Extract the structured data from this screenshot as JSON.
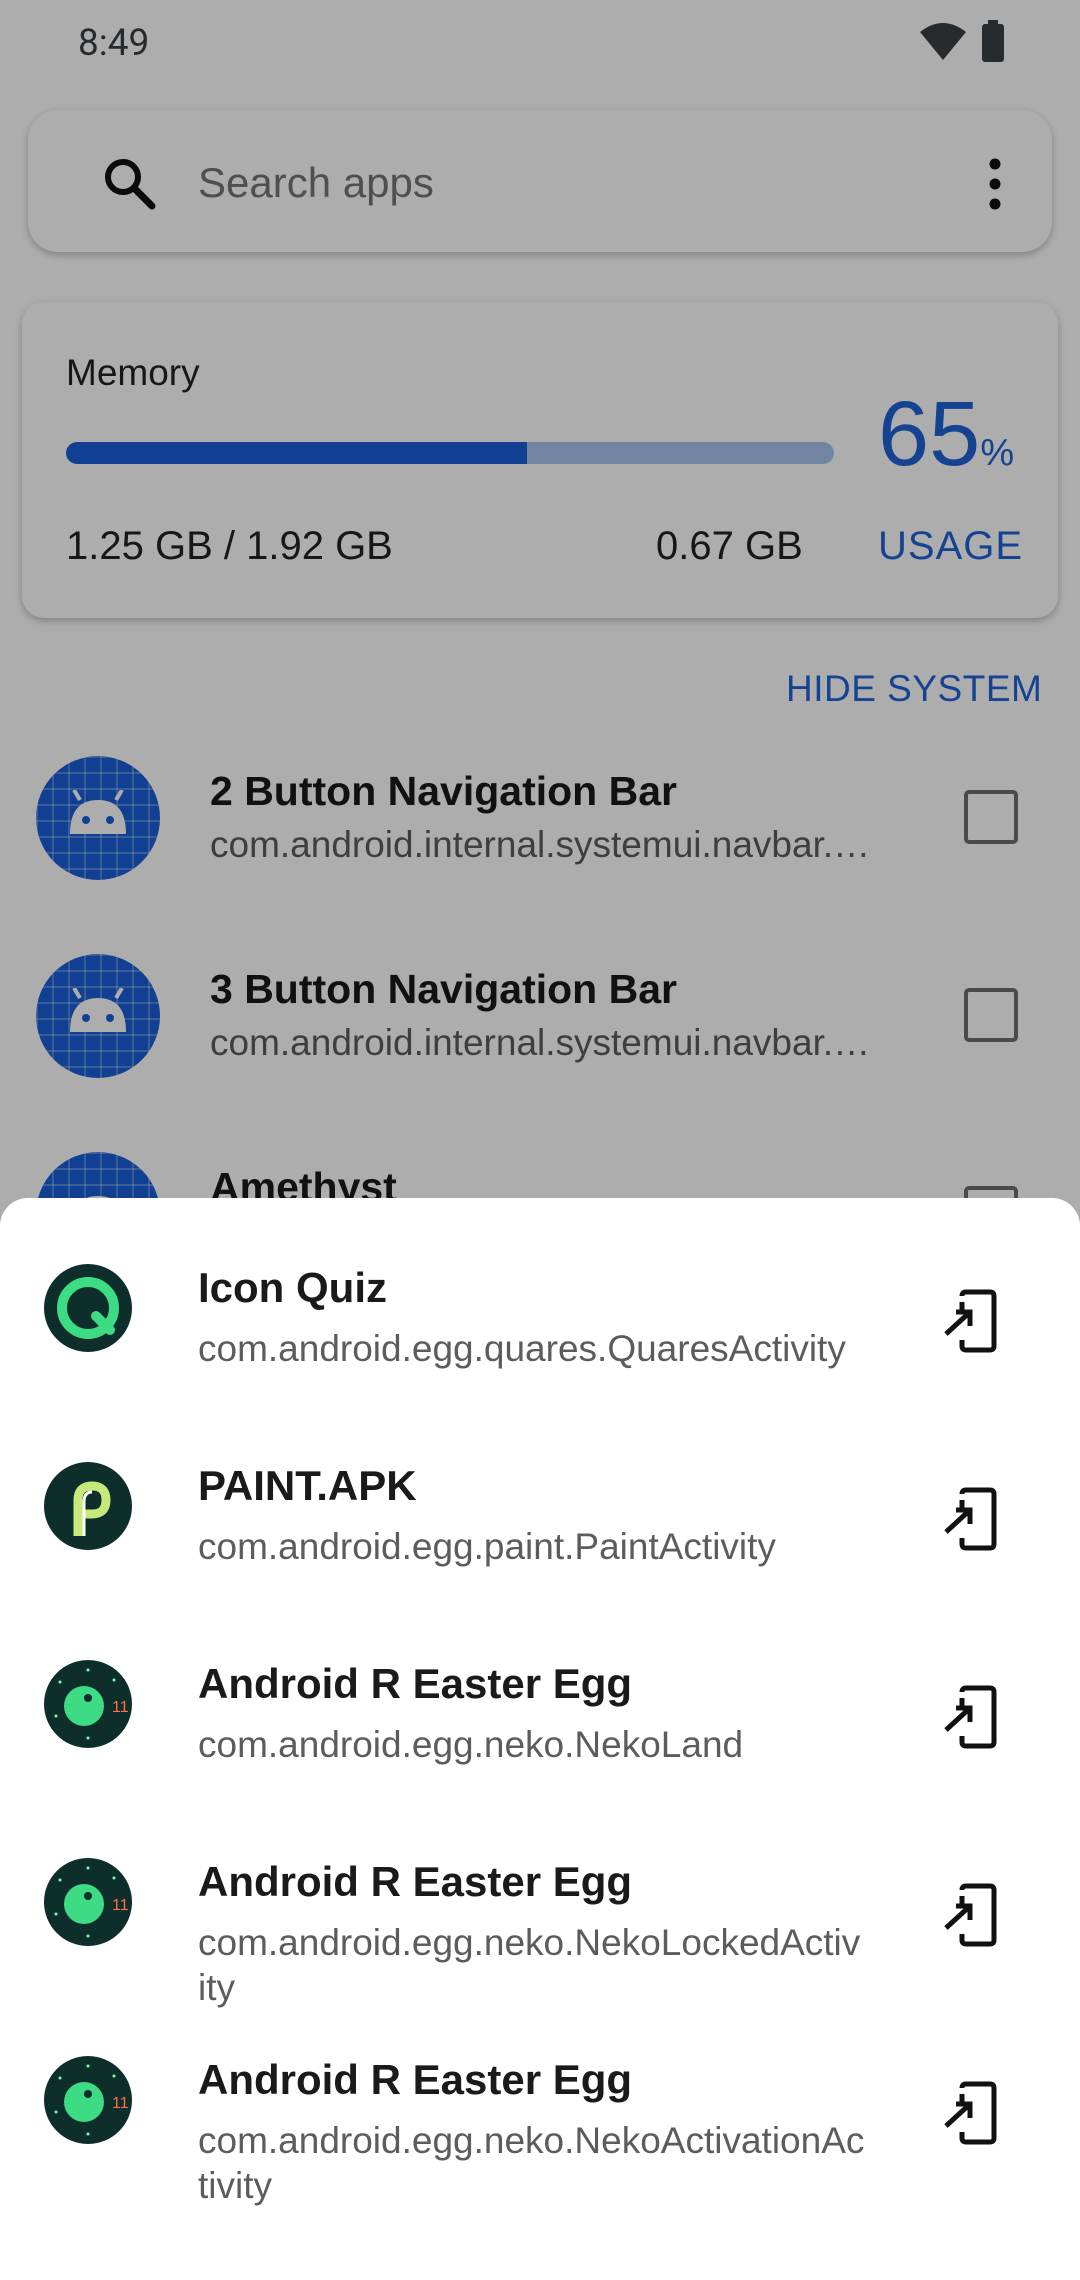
{
  "status_bar": {
    "time": "8:49"
  },
  "search": {
    "placeholder": "Search apps"
  },
  "memory": {
    "title": "Memory",
    "percent": "65",
    "percent_unit": "%",
    "bar_fraction": 0.6,
    "used": "1.25 GB / 1.92 GB",
    "free": "0.67 GB",
    "usage_label": "USAGE"
  },
  "hide_system_label": "HIDE SYSTEM",
  "apps": [
    {
      "name": "2 Button Navigation Bar",
      "package": "com.android.internal.systemui.navbar.…",
      "checked": false
    },
    {
      "name": "3 Button Navigation Bar",
      "package": "com.android.internal.systemui.navbar.…",
      "checked": false
    },
    {
      "name": "Amethyst",
      "package": "",
      "checked": false
    }
  ],
  "activities": [
    {
      "name": "Icon Quiz",
      "class": "com.android.egg.quares.QuaresActivity",
      "icon": "quares-icon"
    },
    {
      "name": "PAINT.APK",
      "class": "com.android.egg.paint.PaintActivity",
      "icon": "paint-icon"
    },
    {
      "name": "Android R Easter Egg",
      "class": "com.android.egg.neko.NekoLand",
      "icon": "android-r-icon"
    },
    {
      "name": "Android R Easter Egg",
      "class": "com.android.egg.neko.NekoLockedActivity",
      "icon": "android-r-icon"
    },
    {
      "name": "Android R Easter Egg",
      "class": "com.android.egg.neko.NekoActivationActivity",
      "icon": "android-r-icon"
    }
  ],
  "colors": {
    "accent": "#1f63d8",
    "scrim": "rgba(0,0,0,0.32)"
  }
}
